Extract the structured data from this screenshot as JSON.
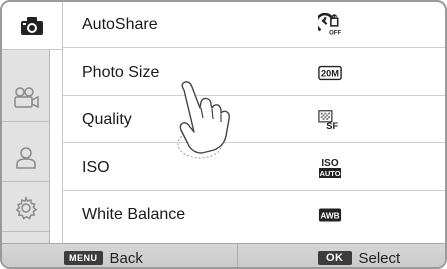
{
  "tabs": [
    {
      "icon": "camera-icon",
      "active": true
    },
    {
      "icon": "video-camera-icon",
      "active": false
    },
    {
      "icon": "person-icon",
      "active": false
    },
    {
      "icon": "gear-icon",
      "active": false
    }
  ],
  "menu": {
    "items": [
      {
        "label": "AutoShare",
        "value_icon": "autoshare-off-icon",
        "value_text": "OFF"
      },
      {
        "label": "Photo Size",
        "value_icon": "photo-size-icon",
        "value_text": "20M"
      },
      {
        "label": "Quality",
        "value_icon": "quality-superfine-icon",
        "value_text": "SF"
      },
      {
        "label": "ISO",
        "value_icon": "iso-auto-icon",
        "value_text": "ISO AUTO"
      },
      {
        "label": "White Balance",
        "value_icon": "white-balance-auto-icon",
        "value_text": "AWB"
      }
    ]
  },
  "bottom_bar": {
    "back_key": "MENU",
    "back_label": "Back",
    "select_key": "OK",
    "select_label": "Select"
  }
}
